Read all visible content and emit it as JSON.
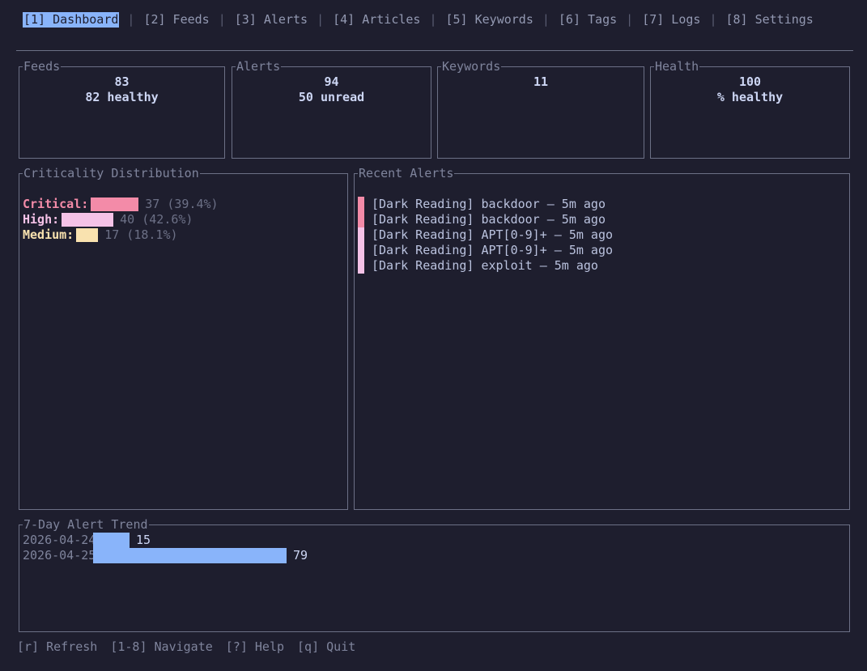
{
  "nav": {
    "tabs": [
      {
        "label": "[1] Dashboard",
        "active": true
      },
      {
        "label": "[2] Feeds",
        "active": false
      },
      {
        "label": "[3] Alerts",
        "active": false
      },
      {
        "label": "[4] Articles",
        "active": false
      },
      {
        "label": "[5] Keywords",
        "active": false
      },
      {
        "label": "[6] Tags",
        "active": false
      },
      {
        "label": "[7] Logs",
        "active": false
      },
      {
        "label": "[8] Settings",
        "active": false
      }
    ]
  },
  "stats": {
    "feeds": {
      "title": "Feeds",
      "value": "83",
      "sub": "82 healthy"
    },
    "alerts": {
      "title": "Alerts",
      "value": "94",
      "sub": "50 unread"
    },
    "keywords": {
      "title": "Keywords",
      "value": "11",
      "sub": ""
    },
    "health": {
      "title": "Health",
      "value": "100",
      "sub": "% healthy"
    }
  },
  "criticality": {
    "title": "Criticality Distribution",
    "rows": [
      {
        "label": "Critical:",
        "count": 37,
        "percent": 39.4,
        "text": "37 (39.4%)",
        "color": "#f38ba8"
      },
      {
        "label": "High:",
        "count": 40,
        "percent": 42.6,
        "text": "40 (42.6%)",
        "color": "#f5c2e7"
      },
      {
        "label": "Medium:",
        "count": 17,
        "percent": 18.1,
        "text": "17 (18.1%)",
        "color": "#f9e2af"
      }
    ]
  },
  "recent_alerts": {
    "title": "Recent Alerts",
    "items": [
      {
        "text": "[Dark Reading] backdoor — 5m ago",
        "severity_color": "#f38ba8"
      },
      {
        "text": "[Dark Reading] backdoor — 5m ago",
        "severity_color": "#f38ba8"
      },
      {
        "text": "[Dark Reading] APT[0-9]+ — 5m ago",
        "severity_color": "#f5c2e7"
      },
      {
        "text": "[Dark Reading] APT[0-9]+ — 5m ago",
        "severity_color": "#f5c2e7"
      },
      {
        "text": "[Dark Reading] exploit — 5m ago",
        "severity_color": "#f5c2e7"
      }
    ]
  },
  "trend": {
    "title": "7-Day Alert Trend",
    "rows": [
      {
        "date": "2026-04-24",
        "value": 15,
        "label": "15"
      },
      {
        "date": "2026-04-25",
        "value": 79,
        "label": "79"
      }
    ]
  },
  "footer": {
    "hints": [
      "[r] Refresh",
      "[1-8] Navigate",
      "[?] Help",
      "[q] Quit"
    ]
  },
  "colors": {
    "background": "#1e1e2e",
    "accent": "#89b4fa",
    "critical": "#f38ba8",
    "high": "#f5c2e7",
    "medium": "#f9e2af"
  }
}
